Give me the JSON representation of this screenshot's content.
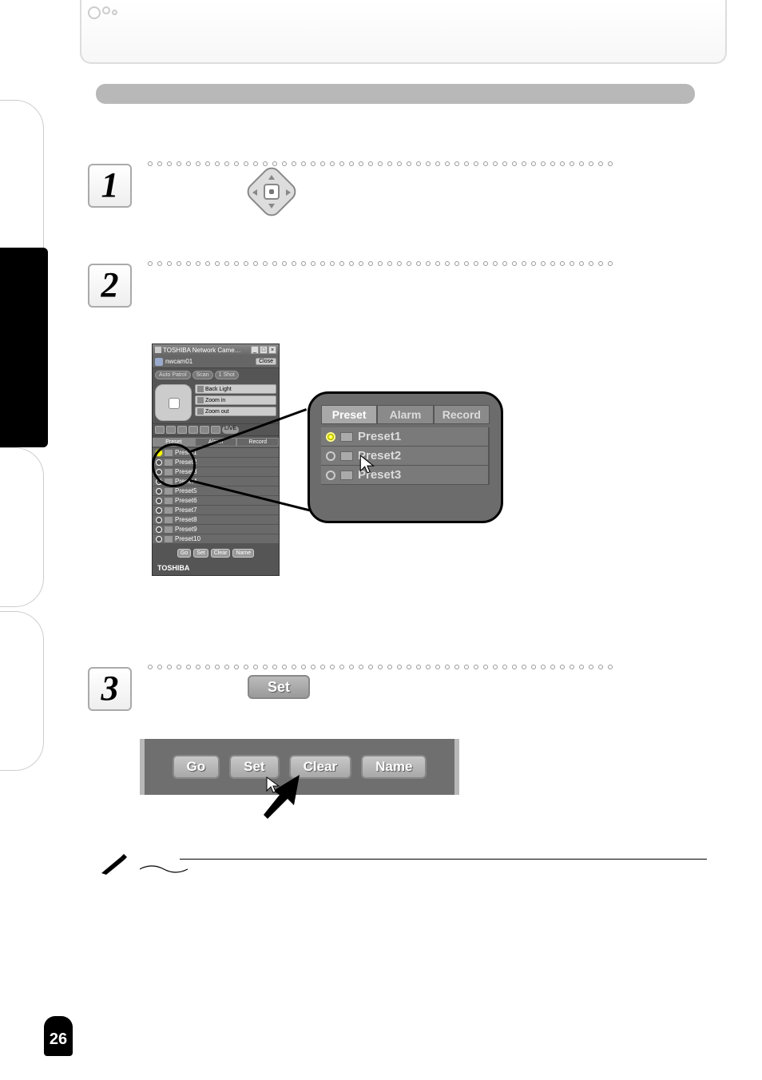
{
  "page_number": "26",
  "steps": {
    "one": "1",
    "two": "2",
    "three": "3"
  },
  "viewer": {
    "title": "TOSHIBA Network Came…",
    "camera_name": "nwcam01",
    "close_label": "Close",
    "auto_patrol": "Auto Patrol",
    "scan": "Scan",
    "one_shot": "1 Shot",
    "back_light": "Back Light",
    "zoom_in": "Zoom in",
    "zoom_out": "Zoom out",
    "live": "LIVE",
    "tabs": {
      "preset": "Preset",
      "alarm": "Alarm",
      "record": "Record"
    },
    "presets": [
      "Preset1",
      "Preset2",
      "Preset3",
      "Preset4",
      "Preset5",
      "Preset6",
      "Preset7",
      "Preset8",
      "Preset9",
      "Preset10"
    ],
    "buttons": {
      "go": "Go",
      "set": "Set",
      "clear": "Clear",
      "name": "Name"
    },
    "brand": "TOSHIBA"
  },
  "callout": {
    "tabs": {
      "preset": "Preset",
      "alarm": "Alarm",
      "record": "Record"
    },
    "presets": [
      "Preset1",
      "Preset2",
      "Preset3"
    ]
  },
  "set_chip": "Set",
  "bottom_bar": {
    "go": "Go",
    "set": "Set",
    "clear": "Clear",
    "name": "Name"
  }
}
